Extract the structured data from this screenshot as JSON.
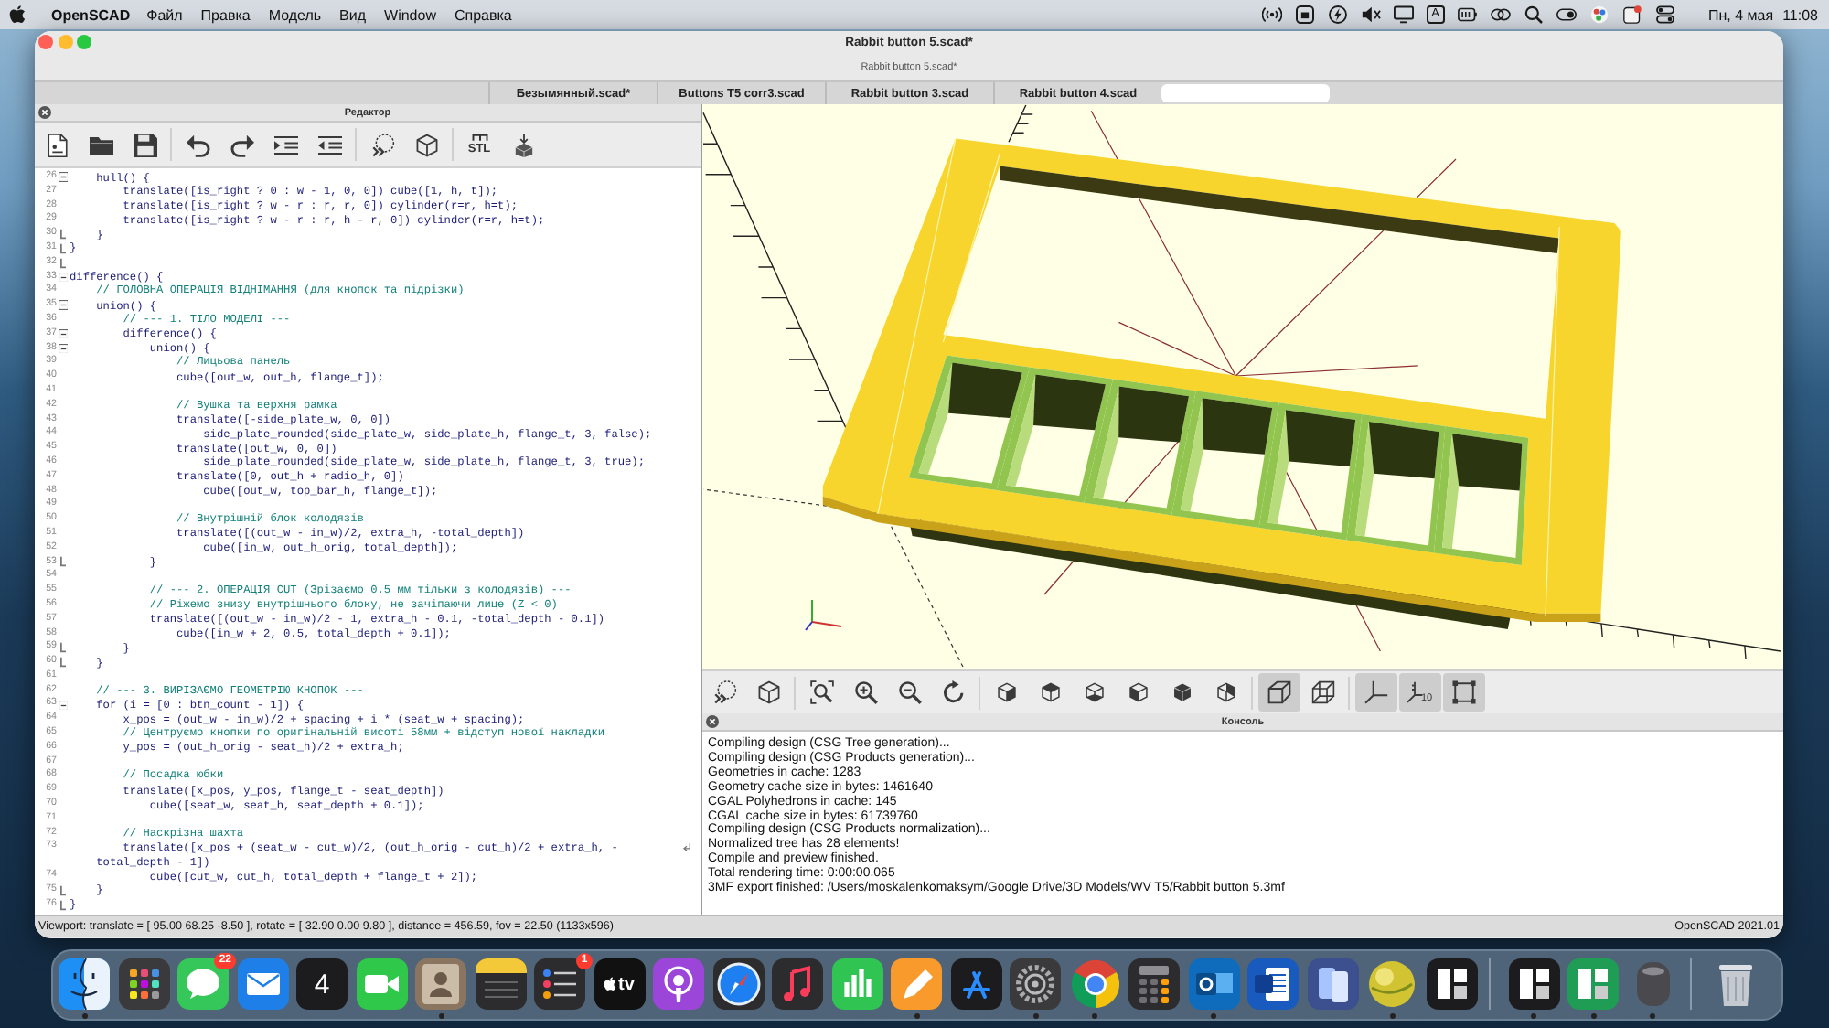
{
  "menu_bar": {
    "app_name": "OpenSCAD",
    "menus": [
      "Файл",
      "Правка",
      "Модель",
      "Вид",
      "Window",
      "Справка"
    ],
    "status_icons": [
      {
        "kind": "radio"
      },
      {
        "kind": "box"
      },
      {
        "kind": "bolt"
      },
      {
        "kind": "mute"
      },
      {
        "kind": "monitor"
      },
      {
        "kind": "input",
        "label": "A"
      },
      {
        "kind": "battery"
      },
      {
        "kind": "rings"
      },
      {
        "kind": "search"
      },
      {
        "kind": "toggle"
      },
      {
        "kind": "dots"
      },
      {
        "kind": "notice"
      },
      {
        "kind": "control"
      }
    ],
    "date": "Пн, 4 мая",
    "time": "11:08"
  },
  "window": {
    "title": "Rabbit button 5.scad*",
    "subtitle": "Rabbit button 5.scad*"
  },
  "tabs": [
    {
      "label": "Безымянный.scad*",
      "selected": false
    },
    {
      "label": "Buttons T5 corr3.scad",
      "selected": false
    },
    {
      "label": "Rabbit button 3.scad",
      "selected": false
    },
    {
      "label": "Rabbit button 4.scad",
      "selected": false
    },
    {
      "selected": true
    }
  ],
  "editor": {
    "title": "Редактор",
    "toolbar": [
      [
        {
          "kind": "new"
        },
        {
          "kind": "open"
        },
        {
          "kind": "save"
        }
      ],
      [
        {
          "kind": "undo"
        },
        {
          "kind": "redo"
        },
        {
          "kind": "indent"
        },
        {
          "kind": "unindent"
        }
      ],
      [
        {
          "kind": "preview"
        },
        {
          "kind": "render"
        }
      ],
      [
        {
          "kind": "export",
          "label": "STL"
        },
        {
          "kind": "print"
        }
      ]
    ],
    "lines": [
      {
        "number": "26",
        "text": "    hull() {",
        "kind": "code",
        "fold_start": true,
        "fold_end": false
      },
      {
        "number": "27",
        "text": "        translate([is_right ? 0 : w - 1, 0, 0]) cube([1, h, t]);",
        "kind": "code",
        "fold_start": false,
        "fold_end": false
      },
      {
        "number": "28",
        "text": "        translate([is_right ? w - r : r, r, 0]) cylinder(r=r, h=t);",
        "kind": "code",
        "fold_start": false,
        "fold_end": false
      },
      {
        "number": "29",
        "text": "        translate([is_right ? w - r : r, h - r, 0]) cylinder(r=r, h=t);",
        "kind": "code",
        "fold_start": false,
        "fold_end": false
      },
      {
        "number": "30",
        "text": "    }",
        "kind": "code",
        "fold_start": false,
        "fold_end": true
      },
      {
        "number": "31",
        "text": "}",
        "kind": "code",
        "fold_start": false,
        "fold_end": true
      },
      {
        "number": "32",
        "fold_start": false,
        "fold_end": true
      },
      {
        "number": "33",
        "text": "difference() {",
        "kind": "code",
        "fold_start": true,
        "fold_end": false
      },
      {
        "number": "34",
        "text": "    // ГОЛОВНА ОПЕРАЦІЯ ВІДНІМАННЯ (для кнопок та підрізки)",
        "kind": "comment",
        "fold_start": false,
        "fold_end": false
      },
      {
        "number": "35",
        "text": "    union() {",
        "kind": "code",
        "fold_start": true,
        "fold_end": false
      },
      {
        "number": "36",
        "text": "        // --- 1. ТІЛО МОДЕЛІ ---",
        "kind": "comment",
        "fold_start": false,
        "fold_end": false
      },
      {
        "number": "37",
        "text": "        difference() {",
        "kind": "code",
        "fold_start": true,
        "fold_end": false
      },
      {
        "number": "38",
        "text": "            union() {",
        "kind": "code",
        "fold_start": true,
        "fold_end": false
      },
      {
        "number": "39",
        "text": "                // Лицьова панель",
        "kind": "comment",
        "fold_start": false,
        "fold_end": false
      },
      {
        "number": "40",
        "text": "                cube([out_w, out_h, flange_t]);",
        "kind": "code",
        "fold_start": false,
        "fold_end": false
      },
      {
        "number": "41",
        "fold_start": false,
        "fold_end": false
      },
      {
        "number": "42",
        "text": "                // Вушка та верхня рамка",
        "kind": "comment",
        "fold_start": false,
        "fold_end": false
      },
      {
        "number": "43",
        "text": "                translate([-side_plate_w, 0, 0])",
        "kind": "code",
        "fold_start": false,
        "fold_end": false
      },
      {
        "number": "44",
        "text": "                    side_plate_rounded(side_plate_w, side_plate_h, flange_t, 3, false);",
        "kind": "code",
        "fold_start": false,
        "fold_end": false
      },
      {
        "number": "45",
        "text": "                translate([out_w, 0, 0])",
        "kind": "code",
        "fold_start": false,
        "fold_end": false
      },
      {
        "number": "46",
        "text": "                    side_plate_rounded(side_plate_w, side_plate_h, flange_t, 3, true);",
        "kind": "code",
        "fold_start": false,
        "fold_end": false
      },
      {
        "number": "47",
        "text": "                translate([0, out_h + radio_h, 0])",
        "kind": "code",
        "fold_start": false,
        "fold_end": false
      },
      {
        "number": "48",
        "text": "                    cube([out_w, top_bar_h, flange_t]);",
        "kind": "code",
        "fold_start": false,
        "fold_end": false
      },
      {
        "number": "49",
        "fold_start": false,
        "fold_end": false
      },
      {
        "number": "50",
        "text": "                // Внутрішній блок колодязів",
        "kind": "comment",
        "fold_start": false,
        "fold_end": false
      },
      {
        "number": "51",
        "text": "                translate([(out_w - in_w)/2, extra_h, -total_depth])",
        "kind": "code",
        "fold_start": false,
        "fold_end": false
      },
      {
        "number": "52",
        "text": "                    cube([in_w, out_h_orig, total_depth]);",
        "kind": "code",
        "fold_start": false,
        "fold_end": false
      },
      {
        "number": "53",
        "text": "            }",
        "kind": "code",
        "fold_start": false,
        "fold_end": true
      },
      {
        "number": "54",
        "fold_start": false,
        "fold_end": false
      },
      {
        "number": "55",
        "text": "            // --- 2. ОПЕРАЦІЯ CUT (Зрізаємо 0.5 мм тільки з колодязів) ---",
        "kind": "comment",
        "fold_start": false,
        "fold_end": false
      },
      {
        "number": "56",
        "text": "            // Ріжемо знизу внутрішнього блоку, не зачіпаючи лице (Z < 0)",
        "kind": "comment",
        "fold_start": false,
        "fold_end": false
      },
      {
        "number": "57",
        "text": "            translate([(out_w - in_w)/2 - 1, extra_h - 0.1, -total_depth - 0.1])",
        "kind": "code",
        "fold_start": false,
        "fold_end": false
      },
      {
        "number": "58",
        "text": "                cube([in_w + 2, 0.5, total_depth + 0.1]);",
        "kind": "code",
        "fold_start": false,
        "fold_end": false
      },
      {
        "number": "59",
        "text": "        }",
        "kind": "code",
        "fold_start": false,
        "fold_end": true
      },
      {
        "number": "60",
        "text": "    }",
        "kind": "code",
        "fold_start": false,
        "fold_end": true
      },
      {
        "number": "61",
        "fold_start": false,
        "fold_end": false
      },
      {
        "number": "62",
        "text": "    // --- 3. ВИРІЗАЄМО ГЕОМЕТРІЮ КНОПОК ---",
        "kind": "comment",
        "fold_start": false,
        "fold_end": false
      },
      {
        "number": "63",
        "text": "    for (i = [0 : btn_count - 1]) {",
        "kind": "code",
        "fold_start": true,
        "fold_end": false
      },
      {
        "number": "64",
        "text": "        x_pos = (out_w - in_w)/2 + spacing + i * (seat_w + spacing);",
        "kind": "code",
        "fold_start": false,
        "fold_end": false
      },
      {
        "number": "65",
        "text": "        // Центруємо кнопки по оригінальній висоті 58мм + відступ нової накладки",
        "kind": "comment",
        "fold_start": false,
        "fold_end": false
      },
      {
        "number": "66",
        "text": "        y_pos = (out_h_orig - seat_h)/2 + extra_h;",
        "kind": "code",
        "fold_start": false,
        "fold_end": false
      },
      {
        "number": "67",
        "fold_start": false,
        "fold_end": false
      },
      {
        "number": "68",
        "text": "        // Посадка юбки",
        "kind": "comment",
        "fold_start": false,
        "fold_end": false
      },
      {
        "number": "69",
        "text": "        translate([x_pos, y_pos, flange_t - seat_depth])",
        "kind": "code",
        "fold_start": false,
        "fold_end": false
      },
      {
        "number": "70",
        "text": "            cube([seat_w, seat_h, seat_depth + 0.1]);",
        "kind": "code",
        "fold_start": false,
        "fold_end": false
      },
      {
        "number": "71",
        "fold_start": false,
        "fold_end": false
      },
      {
        "number": "72",
        "text": "        // Наскрізна шахта",
        "kind": "comment",
        "fold_start": false,
        "fold_end": false
      },
      {
        "number": "73",
        "text": "        translate([x_pos + (seat_w - cut_w)/2, (out_h_orig - cut_h)/2 + extra_h, -",
        "kind": "code",
        "fold_start": false,
        "fold_end": false,
        "wrapped": true
      },
      {
        "text": "    total_depth - 1])",
        "kind": "code",
        "fold_start": false,
        "fold_end": false
      },
      {
        "number": "74",
        "text": "            cube([cut_w, cut_h, total_depth + flange_t + 2]);",
        "kind": "code",
        "fold_start": false,
        "fold_end": false
      },
      {
        "number": "75",
        "text": "    }",
        "kind": "code",
        "fold_start": false,
        "fold_end": true
      },
      {
        "number": "76",
        "text": "}",
        "kind": "code",
        "fold_start": false,
        "fold_end": true
      }
    ]
  },
  "viewport": {
    "toolbar": [
      [
        {
          "kind": "preview"
        },
        {
          "kind": "render"
        }
      ],
      [
        {
          "kind": "view-all"
        },
        {
          "kind": "zoom-in"
        },
        {
          "kind": "zoom-out"
        },
        {
          "kind": "reset"
        }
      ],
      [
        {
          "kind": "right"
        },
        {
          "kind": "top"
        },
        {
          "kind": "bottom"
        },
        {
          "kind": "left"
        },
        {
          "kind": "front"
        },
        {
          "kind": "back"
        }
      ],
      [
        {
          "kind": "perspective",
          "selected": true
        },
        {
          "kind": "orthogonal",
          "selected": false
        }
      ],
      [
        {
          "kind": "axes",
          "selected": true
        },
        {
          "kind": "scale",
          "label": "10",
          "selected": true
        },
        {
          "kind": "edges",
          "selected": true
        }
      ]
    ]
  },
  "console": {
    "title": "Консоль",
    "lines": [
      "Compiling design (CSG Tree generation)...",
      "Compiling design (CSG Products generation)...",
      "Geometries in cache: 1283",
      "Geometry cache size in bytes: 1461640",
      "CGAL Polyhedrons in cache: 145",
      "CGAL cache size in bytes: 61739760",
      "Compiling design (CSG Products normalization)...",
      "Normalized tree has 28 elements!",
      "Compile and preview finished.",
      "Total rendering time: 0:00:00.065",
      "3MF export finished: /Users/moskalenkomaksym/Google Drive/3D Models/WV T5/Rabbit button 5.3mf"
    ]
  },
  "status_bar": {
    "viewport_info": "Viewport: translate = [ 95.00 68.25 -8.50 ], rotate = [ 32.90 0.00 9.80 ], distance = 456.59, fov = 22.50 (1133x596)",
    "version": "OpenSCAD 2021.01"
  },
  "dock": [
    [
      {
        "kind": "face",
        "running": true
      },
      {
        "kind": "grid",
        "running": false
      },
      {
        "kind": "chat",
        "badge": "22",
        "running": false
      },
      {
        "kind": "mail",
        "running": false
      },
      {
        "kind": "calendar",
        "label": "4",
        "running": false
      },
      {
        "kind": "video",
        "running": false
      },
      {
        "kind": "contacts",
        "running": true
      },
      {
        "kind": "notes",
        "running": false
      },
      {
        "kind": "checklist",
        "badge": "1",
        "running": false
      },
      {
        "kind": "tv",
        "label": "tv",
        "running": false
      },
      {
        "kind": "podcast",
        "running": false
      },
      {
        "kind": "compass",
        "running": false
      },
      {
        "kind": "music",
        "running": false
      },
      {
        "kind": "chart",
        "running": false
      },
      {
        "kind": "pen",
        "running": true
      },
      {
        "kind": "store",
        "running": false
      },
      {
        "kind": "gear",
        "running": true
      },
      {
        "kind": "browser",
        "running": true
      },
      {
        "kind": "calculator",
        "running": false
      },
      {
        "kind": "mail-app",
        "running": true
      },
      {
        "kind": "document",
        "running": false
      },
      {
        "kind": "phones",
        "running": false
      },
      {
        "kind": "sphere",
        "running": true
      },
      {
        "kind": "tiles",
        "running": false
      }
    ],
    [
      {
        "kind": "tiles",
        "running": true
      },
      {
        "kind": "green-tiles",
        "running": true
      },
      {
        "kind": "cylinder",
        "running": true
      }
    ],
    [
      {
        "kind": "trash",
        "running": false
      }
    ]
  ]
}
